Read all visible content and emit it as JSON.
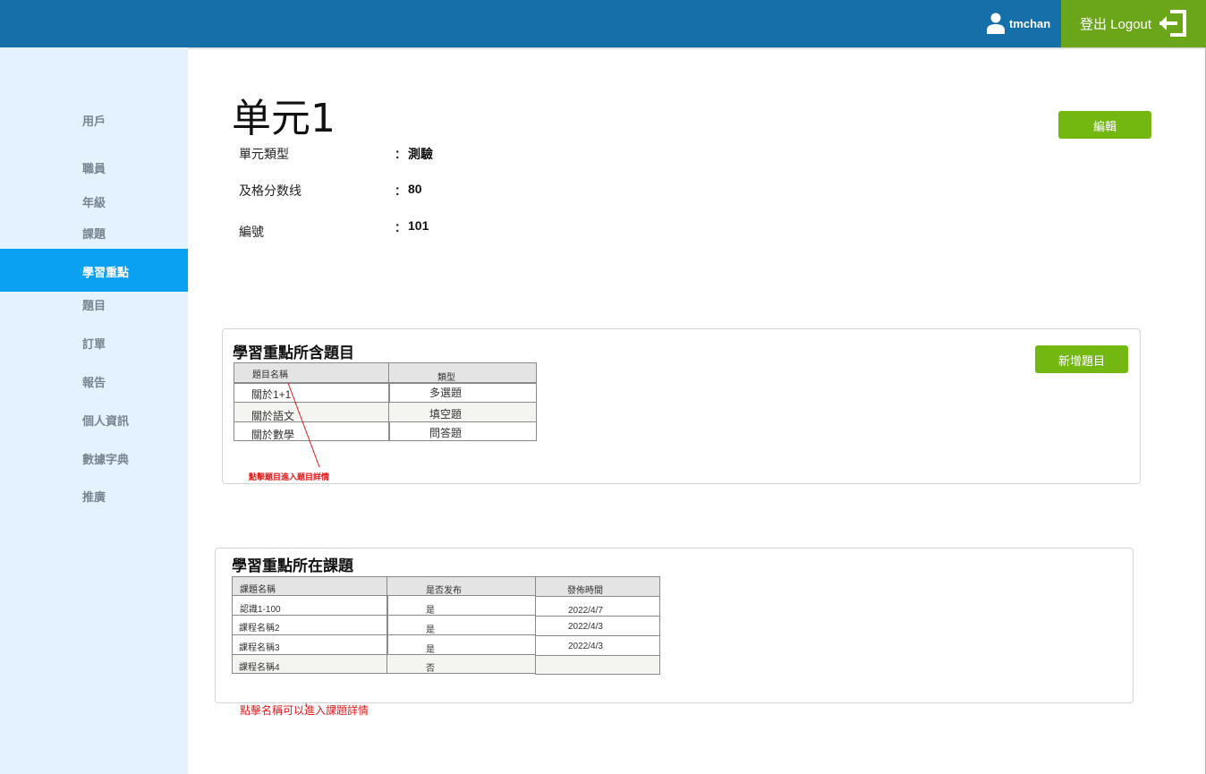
{
  "header": {
    "username": "tmchan",
    "logout_label": "登出 Logout",
    "user_icon": "user-icon",
    "logout_icon": "logout-arrow-icon",
    "colors": {
      "bar": "#156fa8",
      "logout_bg": "#6ba519"
    }
  },
  "sidebar": {
    "items": [
      {
        "label": "用戶"
      },
      {
        "label": "職員"
      },
      {
        "label": "年級"
      },
      {
        "label": "課題"
      },
      {
        "label": "學習重點",
        "active": true
      },
      {
        "label": "題目"
      },
      {
        "label": "訂單"
      },
      {
        "label": "報告"
      },
      {
        "label": "個人資訊"
      },
      {
        "label": "數據字典"
      },
      {
        "label": "推廣"
      }
    ]
  },
  "main": {
    "title": "单元1",
    "edit_label": "編輯",
    "info": [
      {
        "label": "單元類型",
        "colon": "：",
        "value": "測驗"
      },
      {
        "label": "及格分数线",
        "colon": "：",
        "value": "80"
      },
      {
        "label": "編號",
        "colon": "：",
        "value": "101"
      }
    ]
  },
  "questions_panel": {
    "title": "學習重點所含題目",
    "add_label": "新增題目",
    "columns": [
      "題目名稱",
      "類型"
    ],
    "rows": [
      [
        "關於1+1",
        "多選題"
      ],
      [
        "關於語文",
        "填空題"
      ],
      [
        "關於數學",
        "問答題"
      ]
    ],
    "annotation": "點擊題目進入題目詳情"
  },
  "topics_panel": {
    "title": "學習重點所在課題",
    "columns": [
      "課題名稱",
      "是否发布",
      "發佈時間"
    ],
    "rows": [
      [
        "認識1-100",
        "是",
        "2022/4/7"
      ],
      [
        "課程名稱2",
        "是",
        "2022/4/3"
      ],
      [
        "課程名稱3",
        "是",
        "2022/4/3"
      ],
      [
        "課程名稱4",
        "否",
        ""
      ]
    ],
    "annotation": "點擊名稱可以進入課題詳情"
  },
  "colors": {
    "accent_green": "#73b811",
    "sidebar_bg": "#e3f2fe",
    "active_item": "#0aa1f2",
    "annotation_red": "#e21a1a"
  }
}
